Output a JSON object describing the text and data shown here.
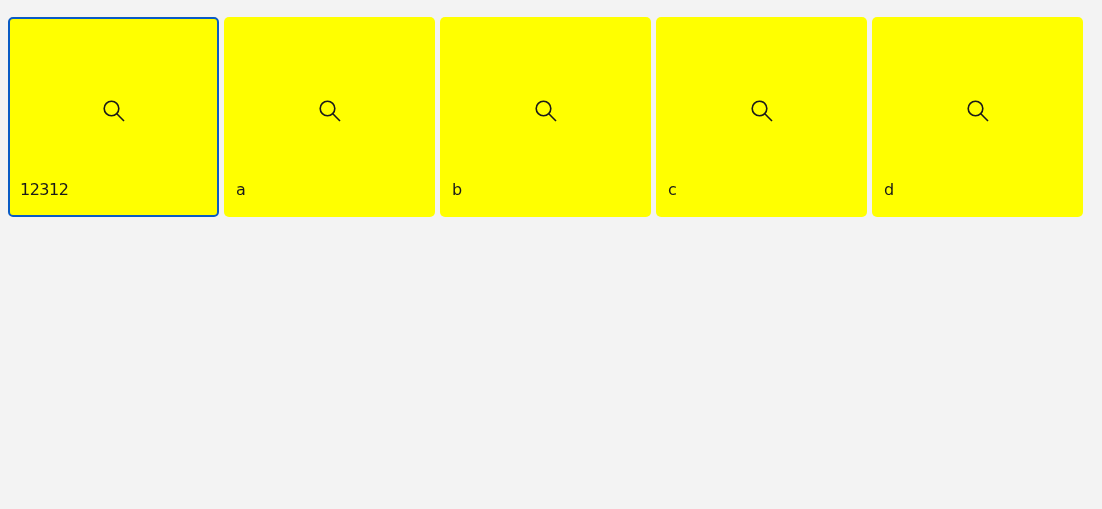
{
  "tiles": [
    {
      "label": "12312",
      "selected": true
    },
    {
      "label": "a",
      "selected": false
    },
    {
      "label": "b",
      "selected": false
    },
    {
      "label": "c",
      "selected": false
    },
    {
      "label": "d",
      "selected": false
    }
  ]
}
